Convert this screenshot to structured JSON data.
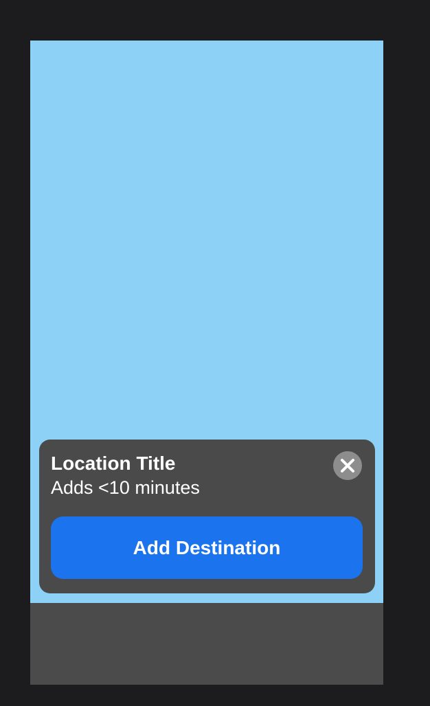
{
  "card": {
    "title": "Location Title",
    "subtitle": "Adds <10 minutes",
    "cta_label": "Add Destination",
    "close_icon": "close-icon"
  },
  "colors": {
    "window_background": "#1c1c1e",
    "map_background": "#8ed1f7",
    "card_background": "#4a4a4a",
    "bottom_bar": "#4b4b4b",
    "primary_button": "#1c73ee",
    "close_button": "#8d8d8d"
  }
}
